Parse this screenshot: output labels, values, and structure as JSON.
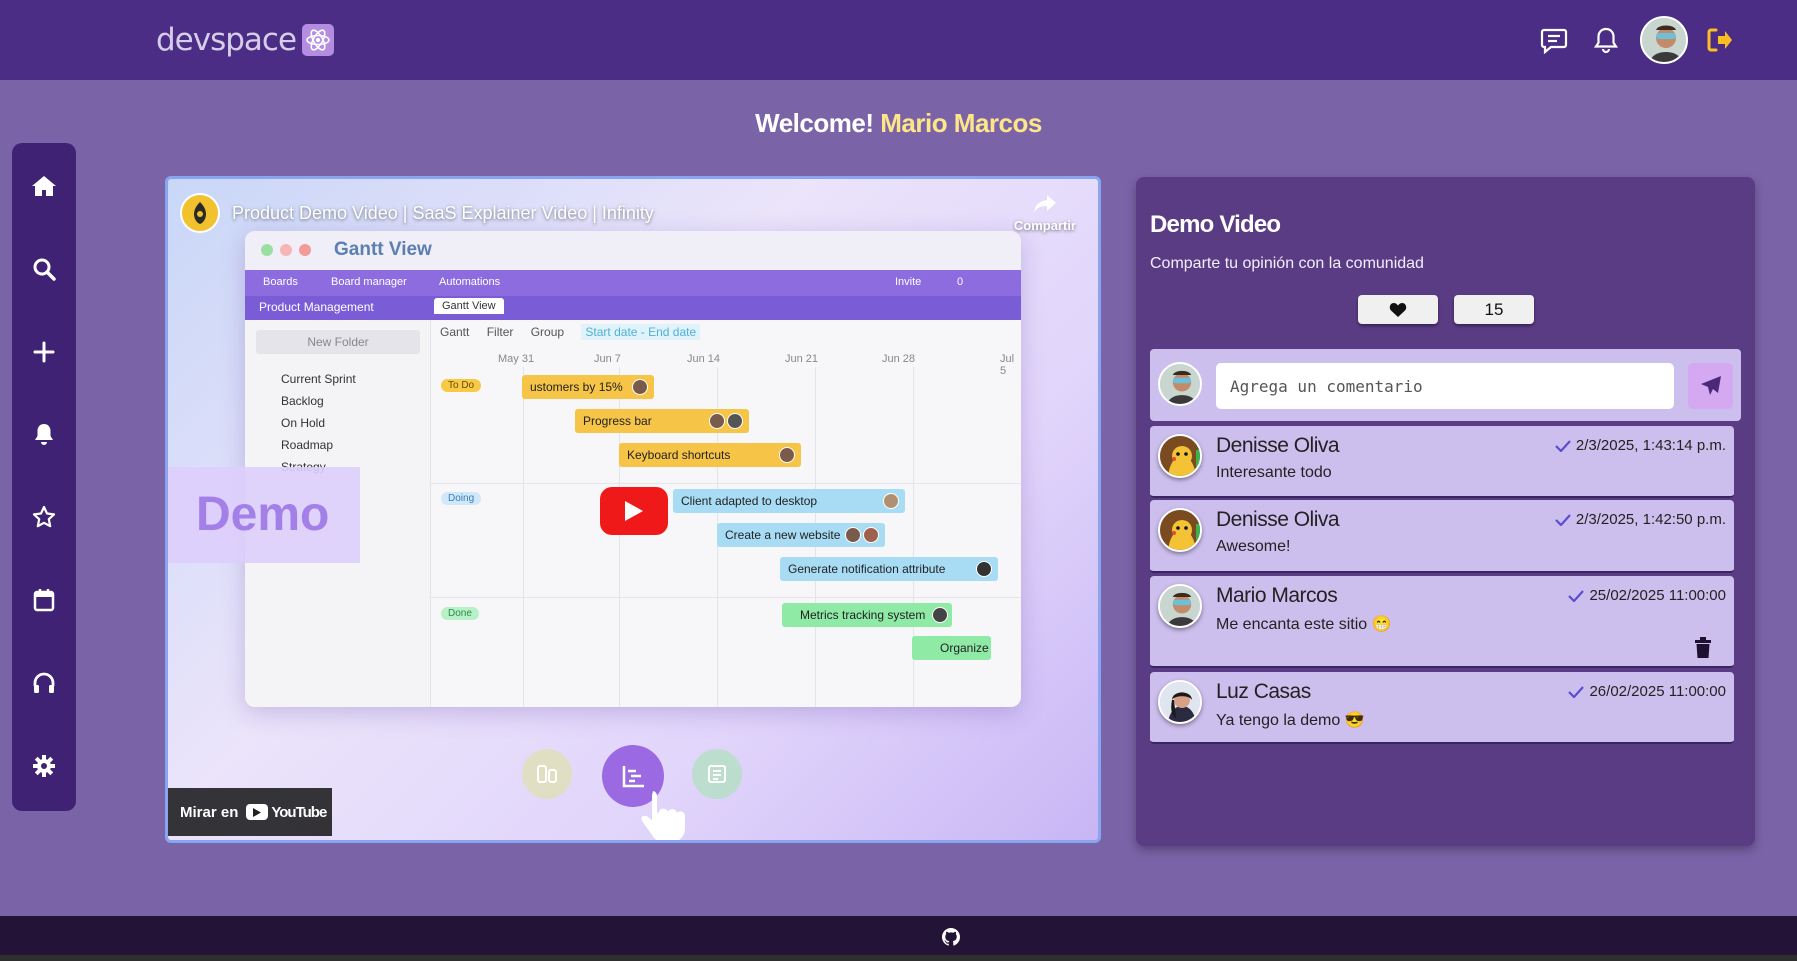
{
  "header": {
    "logo_text": "devspace",
    "icons": [
      "chat-icon",
      "bell-icon",
      "user-avatar",
      "logout-icon"
    ],
    "accent_color": "#fbbf24"
  },
  "welcome": {
    "prefix": "Welcome!",
    "user_name": "Mario Marcos"
  },
  "sidebar": {
    "items": [
      "home-icon",
      "search-icon",
      "plus-icon",
      "bell-icon",
      "star-icon",
      "calendar-icon",
      "headphones-icon",
      "gear-icon"
    ]
  },
  "video": {
    "title": "Product Demo Video | SaaS Explainer Video | Infinity",
    "share_label": "Compartir",
    "watch_on_label": "Mirar en",
    "youtube_label": "YouTube",
    "overlay_word": "Demo",
    "gantt": {
      "title": "Gantt View",
      "toolbar": [
        "Boards",
        "Board manager",
        "Automations",
        "Invite",
        "0"
      ],
      "section": "Product Management",
      "tab": "Gantt View",
      "new_folder": "New Folder",
      "folders": [
        "Current Sprint",
        "Backlog",
        "On Hold",
        "Roadmap",
        "Strategy"
      ],
      "filters": [
        "Gantt",
        "Filter",
        "Group",
        "Start date - End date"
      ],
      "dates": [
        "May 31",
        "Jun 7",
        "Jun 14",
        "Jun 21",
        "Jun 28",
        "Jul 5"
      ],
      "tags": [
        "To Do",
        "Doing",
        "Done"
      ],
      "tasks": [
        "ustomers by 15%",
        "Progress bar",
        "Keyboard shortcuts",
        "Client adapted to desktop",
        "Create a new website",
        "Generate notification attribute",
        "Metrics tracking system",
        "Organize"
      ]
    }
  },
  "panel": {
    "title": "Demo Video",
    "subtitle": "Comparte tu opinión con la comunidad",
    "like_count": "15",
    "comment_placeholder": "Agrega un comentario",
    "comments": [
      {
        "name": "Denisse Oliva",
        "date": "2/3/2025, 1:43:14 p.m.",
        "text": "Interesante todo",
        "avatar": "pikachu-avatar"
      },
      {
        "name": "Denisse Oliva",
        "date": "2/3/2025, 1:42:50 p.m.",
        "text": "Awesome!",
        "avatar": "pikachu-avatar"
      },
      {
        "name": "Mario Marcos",
        "date": "25/02/2025 11:00:00",
        "text": "Me encanta este sitio 😁",
        "avatar": "user-avatar"
      },
      {
        "name": "Luz Casas",
        "date": "26/02/2025 11:00:00",
        "text": "Ya tengo la demo 😎",
        "avatar": "woman-avatar"
      }
    ]
  },
  "footer": {
    "icon": "github-icon"
  }
}
